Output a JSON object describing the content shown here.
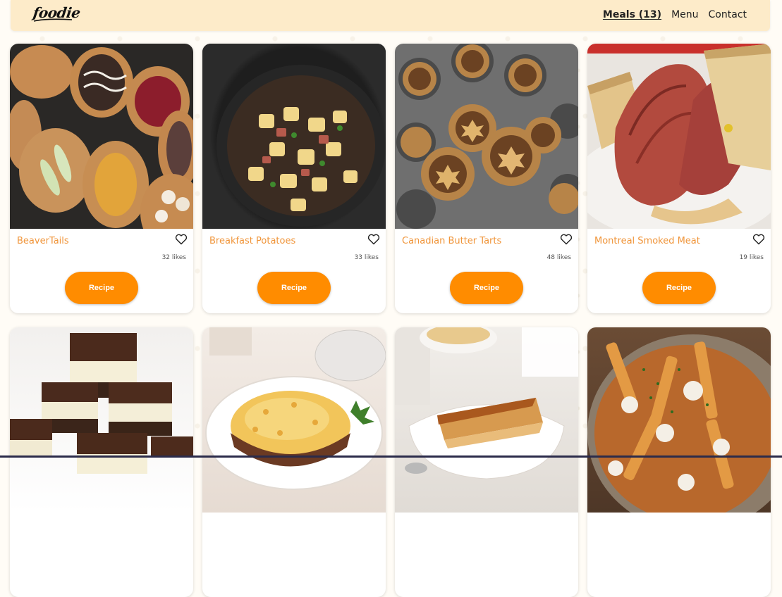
{
  "brand": {
    "logo_text": "foodie"
  },
  "nav": {
    "links": [
      {
        "label": "Meals (13)",
        "active": true
      },
      {
        "label": "Menu",
        "active": false
      },
      {
        "label": "Contact",
        "active": false
      }
    ]
  },
  "meals": [
    {
      "name": "BeaverTails",
      "likes": "32 likes",
      "button": "Recipe",
      "image": "beavertails-photo"
    },
    {
      "name": "Breakfast Potatoes",
      "likes": "33 likes",
      "button": "Recipe",
      "image": "breakfast-potatoes-photo"
    },
    {
      "name": "Canadian Butter Tarts",
      "likes": "48 likes",
      "button": "Recipe",
      "image": "butter-tarts-photo"
    },
    {
      "name": "Montreal Smoked Meat",
      "likes": "19 likes",
      "button": "Recipe",
      "image": "smoked-meat-photo"
    },
    {
      "image": "nanaimo-bars-photo"
    },
    {
      "image": "shepherds-pie-photo"
    },
    {
      "image": "pouding-chomeur-photo"
    },
    {
      "image": "poutine-photo"
    }
  ],
  "colors": {
    "accent": "#ff8c00",
    "title": "#f0953a",
    "navbar": "#fdebc9",
    "background": "#fffcf6"
  },
  "icons": {
    "like": "heart-outline-icon"
  }
}
